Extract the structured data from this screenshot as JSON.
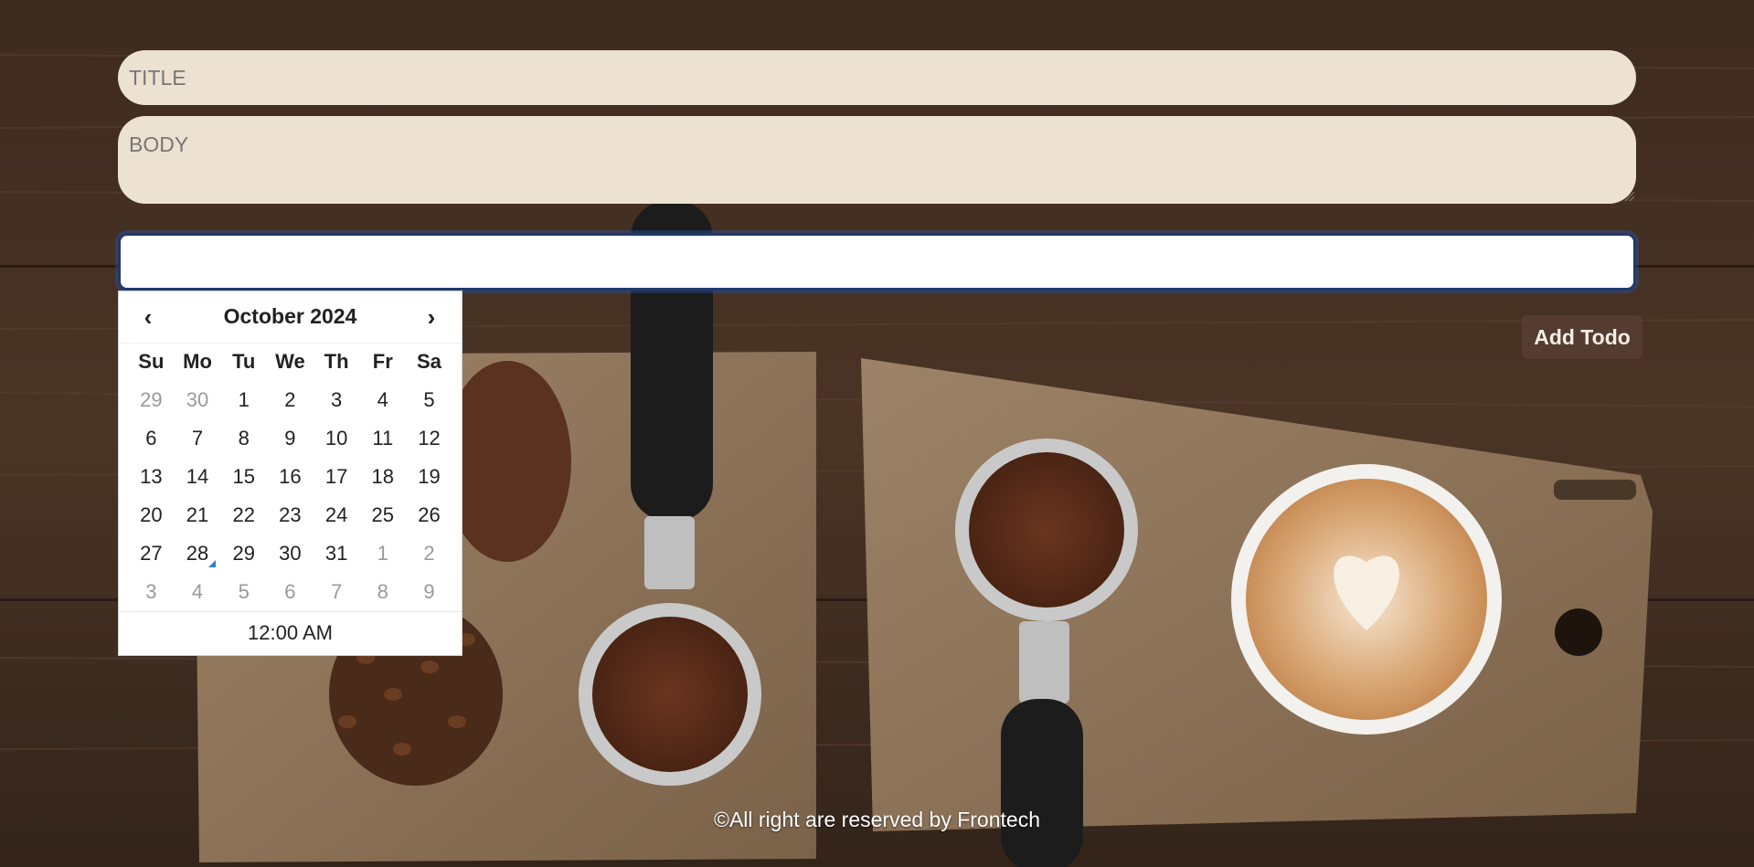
{
  "form": {
    "title_placeholder": "TITLE",
    "body_placeholder": "BODY",
    "date_value": "",
    "add_button_label": "Add Todo"
  },
  "calendar": {
    "month_label": "October 2024",
    "prev_symbol": "‹",
    "next_symbol": "›",
    "weekdays": [
      "Su",
      "Mo",
      "Tu",
      "We",
      "Th",
      "Fr",
      "Sa"
    ],
    "weeks": [
      [
        {
          "d": "29",
          "muted": true
        },
        {
          "d": "30",
          "muted": true
        },
        {
          "d": "1"
        },
        {
          "d": "2"
        },
        {
          "d": "3"
        },
        {
          "d": "4"
        },
        {
          "d": "5"
        }
      ],
      [
        {
          "d": "6"
        },
        {
          "d": "7"
        },
        {
          "d": "8"
        },
        {
          "d": "9"
        },
        {
          "d": "10"
        },
        {
          "d": "11"
        },
        {
          "d": "12"
        }
      ],
      [
        {
          "d": "13"
        },
        {
          "d": "14"
        },
        {
          "d": "15"
        },
        {
          "d": "16"
        },
        {
          "d": "17"
        },
        {
          "d": "18"
        },
        {
          "d": "19"
        }
      ],
      [
        {
          "d": "20"
        },
        {
          "d": "21"
        },
        {
          "d": "22"
        },
        {
          "d": "23"
        },
        {
          "d": "24"
        },
        {
          "d": "25"
        },
        {
          "d": "26"
        }
      ],
      [
        {
          "d": "27"
        },
        {
          "d": "28",
          "today": true
        },
        {
          "d": "29"
        },
        {
          "d": "30"
        },
        {
          "d": "31"
        },
        {
          "d": "1",
          "muted": true
        },
        {
          "d": "2",
          "muted": true
        }
      ],
      [
        {
          "d": "3",
          "muted": true
        },
        {
          "d": "4",
          "muted": true
        },
        {
          "d": "5",
          "muted": true
        },
        {
          "d": "6",
          "muted": true
        },
        {
          "d": "7",
          "muted": true
        },
        {
          "d": "8",
          "muted": true
        },
        {
          "d": "9",
          "muted": true
        }
      ]
    ],
    "time_label": "12:00 AM"
  },
  "footer": {
    "text": "©All right are reserved by Frontech"
  },
  "colors": {
    "field_bg": "#ede1d1",
    "focus_border": "#1e3a70",
    "button_bg": "#583e32",
    "today_marker": "#2f7fd6"
  }
}
